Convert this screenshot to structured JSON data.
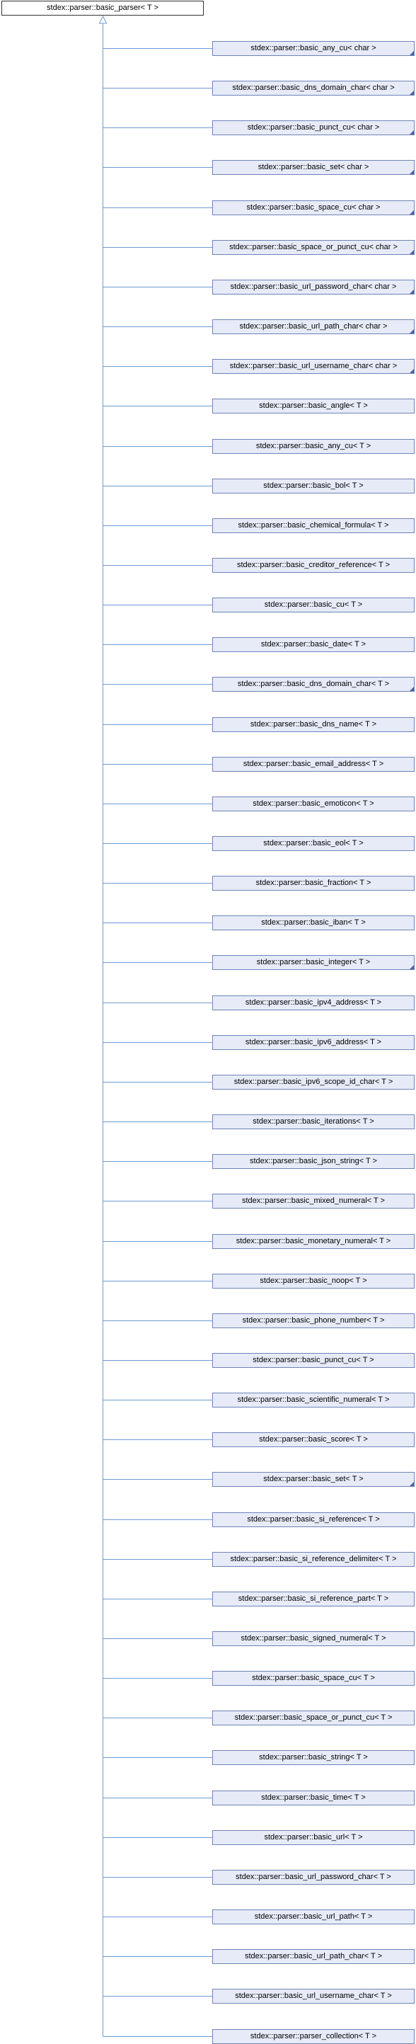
{
  "diagram": {
    "root": {
      "label": "stdex::parser::basic_parser< T >"
    },
    "children": [
      {
        "label": "stdex::parser::basic_any_cu< char >",
        "has_more": true
      },
      {
        "label": "stdex::parser::basic_dns_domain_char< char >",
        "has_more": true
      },
      {
        "label": "stdex::parser::basic_punct_cu< char >",
        "has_more": true
      },
      {
        "label": "stdex::parser::basic_set< char >",
        "has_more": true
      },
      {
        "label": "stdex::parser::basic_space_cu< char >",
        "has_more": true
      },
      {
        "label": "stdex::parser::basic_space_or_punct_cu< char >",
        "has_more": true
      },
      {
        "label": "stdex::parser::basic_url_password_char< char >",
        "has_more": true
      },
      {
        "label": "stdex::parser::basic_url_path_char< char >",
        "has_more": true
      },
      {
        "label": "stdex::parser::basic_url_username_char< char >",
        "has_more": true
      },
      {
        "label": "stdex::parser::basic_angle< T >",
        "has_more": false
      },
      {
        "label": "stdex::parser::basic_any_cu< T >",
        "has_more": false
      },
      {
        "label": "stdex::parser::basic_bol< T >",
        "has_more": false
      },
      {
        "label": "stdex::parser::basic_chemical_formula< T >",
        "has_more": false
      },
      {
        "label": "stdex::parser::basic_creditor_reference< T >",
        "has_more": false
      },
      {
        "label": "stdex::parser::basic_cu< T >",
        "has_more": false
      },
      {
        "label": "stdex::parser::basic_date< T >",
        "has_more": false
      },
      {
        "label": "stdex::parser::basic_dns_domain_char< T >",
        "has_more": true
      },
      {
        "label": "stdex::parser::basic_dns_name< T >",
        "has_more": false
      },
      {
        "label": "stdex::parser::basic_email_address< T >",
        "has_more": false
      },
      {
        "label": "stdex::parser::basic_emoticon< T >",
        "has_more": false
      },
      {
        "label": "stdex::parser::basic_eol< T >",
        "has_more": false
      },
      {
        "label": "stdex::parser::basic_fraction< T >",
        "has_more": false
      },
      {
        "label": "stdex::parser::basic_iban< T >",
        "has_more": false
      },
      {
        "label": "stdex::parser::basic_integer< T >",
        "has_more": true
      },
      {
        "label": "stdex::parser::basic_ipv4_address< T >",
        "has_more": false
      },
      {
        "label": "stdex::parser::basic_ipv6_address< T >",
        "has_more": false
      },
      {
        "label": "stdex::parser::basic_ipv6_scope_id_char< T >",
        "has_more": false
      },
      {
        "label": "stdex::parser::basic_iterations< T >",
        "has_more": false
      },
      {
        "label": "stdex::parser::basic_json_string< T >",
        "has_more": false
      },
      {
        "label": "stdex::parser::basic_mixed_numeral< T >",
        "has_more": false
      },
      {
        "label": "stdex::parser::basic_monetary_numeral< T >",
        "has_more": false
      },
      {
        "label": "stdex::parser::basic_noop< T >",
        "has_more": false
      },
      {
        "label": "stdex::parser::basic_phone_number< T >",
        "has_more": false
      },
      {
        "label": "stdex::parser::basic_punct_cu< T >",
        "has_more": false
      },
      {
        "label": "stdex::parser::basic_scientific_numeral< T >",
        "has_more": false
      },
      {
        "label": "stdex::parser::basic_score< T >",
        "has_more": false
      },
      {
        "label": "stdex::parser::basic_set< T >",
        "has_more": true
      },
      {
        "label": "stdex::parser::basic_si_reference< T >",
        "has_more": false
      },
      {
        "label": "stdex::parser::basic_si_reference_delimiter< T >",
        "has_more": false
      },
      {
        "label": "stdex::parser::basic_si_reference_part< T >",
        "has_more": false
      },
      {
        "label": "stdex::parser::basic_signed_numeral< T >",
        "has_more": false
      },
      {
        "label": "stdex::parser::basic_space_cu< T >",
        "has_more": false
      },
      {
        "label": "stdex::parser::basic_space_or_punct_cu< T >",
        "has_more": false
      },
      {
        "label": "stdex::parser::basic_string< T >",
        "has_more": false
      },
      {
        "label": "stdex::parser::basic_time< T >",
        "has_more": false
      },
      {
        "label": "stdex::parser::basic_url< T >",
        "has_more": false
      },
      {
        "label": "stdex::parser::basic_url_password_char< T >",
        "has_more": false
      },
      {
        "label": "stdex::parser::basic_url_path< T >",
        "has_more": false
      },
      {
        "label": "stdex::parser::basic_url_path_char< T >",
        "has_more": false
      },
      {
        "label": "stdex::parser::basic_url_username_char< T >",
        "has_more": false
      },
      {
        "label": "stdex::parser::parser_collection< T >",
        "has_more": false
      }
    ]
  }
}
